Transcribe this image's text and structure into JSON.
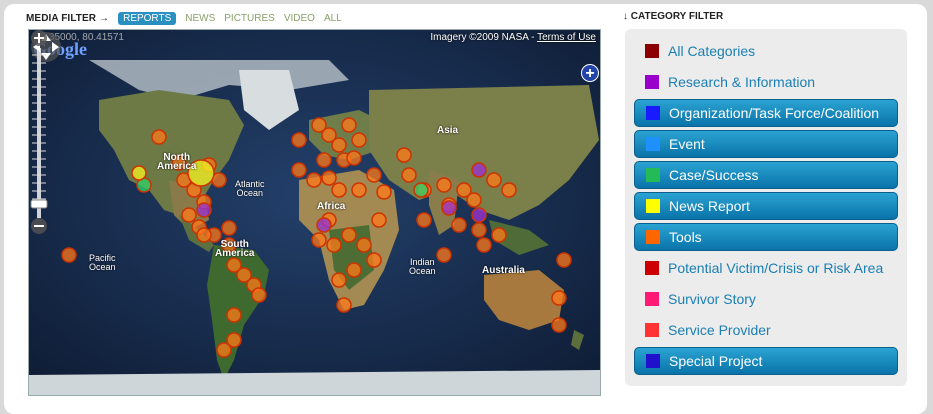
{
  "media_filter": {
    "label": "MEDIA FILTER",
    "arrow": "→",
    "tabs": [
      "REPORTS",
      "NEWS",
      "PICTURES",
      "VIDEO",
      "ALL"
    ],
    "active": "REPORTS"
  },
  "map": {
    "coordinates": "78.35000, 80.41571",
    "logo": "Google",
    "attribution": "Imagery ©2009 NASA -",
    "terms_link": "Terms of Use",
    "zoom_in": "+",
    "zoom_out": "−",
    "overview_button": "+",
    "labels": {
      "north_america_1": "North",
      "north_america_2": "America",
      "atlantic_1": "Atlantic",
      "atlantic_2": "Ocean",
      "pacific_1": "Pacific",
      "pacific_2": "Ocean",
      "south_america_1": "South",
      "south_america_2": "America",
      "africa": "Africa",
      "asia": "Asia",
      "indian_1": "Indian",
      "indian_2": "Ocean",
      "australia": "Australia"
    }
  },
  "category_filter": {
    "arrow": "↓",
    "title": "CATEGORY FILTER",
    "items": [
      {
        "label": "All Categories",
        "color": "#8b0000",
        "selected": false
      },
      {
        "label": "Research & Information",
        "color": "#9900cc",
        "selected": false
      },
      {
        "label": "Organization/Task Force/Coalition",
        "color": "#1a1aff",
        "selected": true
      },
      {
        "label": "Event",
        "color": "#1e90ff",
        "selected": true
      },
      {
        "label": "Case/Success",
        "color": "#22bb55",
        "selected": true
      },
      {
        "label": "News Report",
        "color": "#ffff00",
        "selected": true
      },
      {
        "label": "Tools",
        "color": "#ff6600",
        "selected": true
      },
      {
        "label": "Potential Victim/Crisis or Risk Area",
        "color": "#cc0000",
        "selected": false
      },
      {
        "label": "Survivor Story",
        "color": "#ff1a75",
        "selected": false
      },
      {
        "label": "Service Provider",
        "color": "#ff3333",
        "selected": false
      },
      {
        "label": "Special Project",
        "color": "#2211cc",
        "selected": true
      }
    ]
  }
}
